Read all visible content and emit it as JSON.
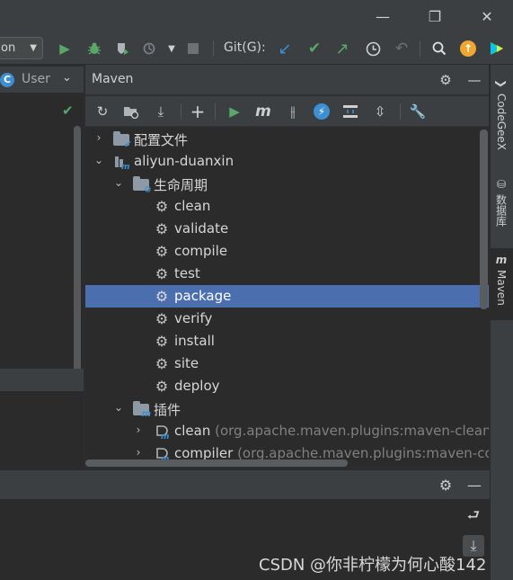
{
  "titlebar": {
    "minimize_glyph": "—",
    "restore_glyph": "❐",
    "close_glyph": "✕"
  },
  "toolbar": {
    "run_config_value": "on",
    "git_label": "Git(G):"
  },
  "left_panel": {
    "tab_label": "User",
    "tab_icon_letter": "C"
  },
  "maven": {
    "title": "Maven",
    "tree": [
      {
        "label": "配置文件",
        "depth": 0,
        "arrow": "›",
        "icon": "folder-check"
      },
      {
        "label": "aliyun-duanxin",
        "depth": 0,
        "arrow": "⌄",
        "icon": "maven-project"
      },
      {
        "label": "生命周期",
        "depth": 1,
        "arrow": "⌄",
        "icon": "folder-gear"
      },
      {
        "label": "clean",
        "depth": 2,
        "arrow": "",
        "icon": "gear"
      },
      {
        "label": "validate",
        "depth": 2,
        "arrow": "",
        "icon": "gear"
      },
      {
        "label": "compile",
        "depth": 2,
        "arrow": "",
        "icon": "gear"
      },
      {
        "label": "test",
        "depth": 2,
        "arrow": "",
        "icon": "gear"
      },
      {
        "label": "package",
        "depth": 2,
        "arrow": "",
        "icon": "gear",
        "selected": true
      },
      {
        "label": "verify",
        "depth": 2,
        "arrow": "",
        "icon": "gear"
      },
      {
        "label": "install",
        "depth": 2,
        "arrow": "",
        "icon": "gear"
      },
      {
        "label": "site",
        "depth": 2,
        "arrow": "",
        "icon": "gear"
      },
      {
        "label": "deploy",
        "depth": 2,
        "arrow": "",
        "icon": "gear"
      },
      {
        "label": "插件",
        "depth": 1,
        "arrow": "⌄",
        "icon": "folder-plugin"
      },
      {
        "label": "clean",
        "sub": " (org.apache.maven.plugins:maven-clean-p",
        "depth": 2,
        "arrow": "›",
        "icon": "plugin"
      },
      {
        "label": "compiler",
        "sub": " (org.apache.maven.plugins:maven-com",
        "depth": 2,
        "arrow": "›",
        "icon": "plugin"
      }
    ]
  },
  "right_strip": {
    "tabs": [
      {
        "label": "CodeGeeX",
        "icon_glyph": "❯"
      },
      {
        "label": "数据库",
        "icon_glyph": "⛁"
      },
      {
        "label": "Maven",
        "icon_glyph": "m"
      }
    ]
  },
  "watermark": "CSDN @你非柠檬为何心酸142",
  "colors": {
    "selection": "#4b6eaf",
    "run_green": "#59a869",
    "git_blue": "#3d8fd1",
    "update_orange": "#f0a732"
  }
}
